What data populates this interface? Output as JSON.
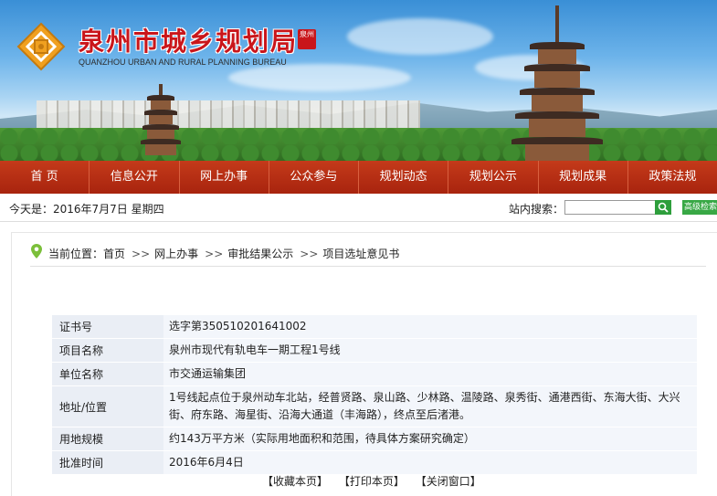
{
  "header": {
    "title_cn": "泉州市城乡规划局",
    "seal_text": "泉州",
    "title_en": "QUANZHOU URBAN AND RURAL PLANNING BUREAU"
  },
  "nav": {
    "items": [
      "首 页",
      "信息公开",
      "网上办事",
      "公众参与",
      "规划动态",
      "规划公示",
      "规划成果",
      "政策法规"
    ]
  },
  "infobar": {
    "date_text": "今天是：2016年7月7日 星期四",
    "search_label": "站内搜索：",
    "search_button": "Q",
    "advanced_search": "高级检索"
  },
  "breadcrumb": {
    "prefix": "当前位置：",
    "items": [
      "首页",
      "网上办事",
      "审批结果公示",
      "项目选址意见书"
    ],
    "separator": ">>"
  },
  "record": {
    "rows": [
      {
        "label": "证书号",
        "value": "选字第350510201641002"
      },
      {
        "label": "项目名称",
        "value": "泉州市现代有轨电车一期工程1号线"
      },
      {
        "label": "单位名称",
        "value": "市交通运输集团"
      },
      {
        "label": "地址/位置",
        "value": "1号线起点位于泉州动车北站，经普贤路、泉山路、少林路、温陵路、泉秀街、通港西街、东海大街、大兴街、府东路、海星街、沿海大通道（丰海路），终点至后渚港。"
      },
      {
        "label": "用地规模",
        "value": "约143万平方米（实际用地面积和范围，待具体方案研究确定）"
      },
      {
        "label": "批准时间",
        "value": "2016年6月4日"
      }
    ]
  },
  "actions": {
    "favorite": "【收藏本页】",
    "print": "【打印本页】",
    "close": "【关闭窗口】"
  },
  "colors": {
    "nav_bg": "#b22d12",
    "title_red": "#c9161b",
    "search_green": "#2e9e3c"
  }
}
